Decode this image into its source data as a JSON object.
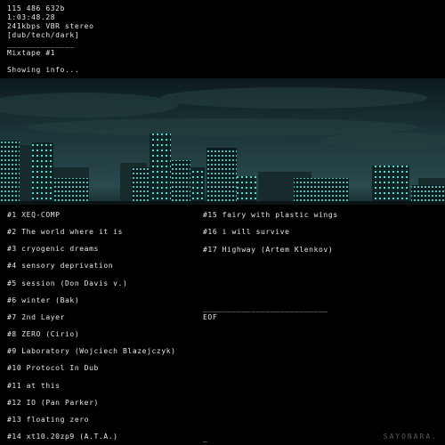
{
  "header": {
    "size": "115 486 632b",
    "duration": "1:03:48.28",
    "bitrate": "241kbps VBR stereo",
    "genre": "[dub/tech/dark]",
    "rule": "______________",
    "title": "Mixtape #1"
  },
  "status": "Showing info...",
  "colors": {
    "text": "#e6e6e6",
    "background": "#000000",
    "sky": "#1e3a3d",
    "window_glow": "#47d6cc"
  },
  "tracks": [
    "#1 XEQ-COMP",
    "#2 The world where it is",
    "#3 cryogenic dreams",
    "#4 sensory deprivation",
    "#5 session (Don Davis v.)",
    "#6 winter (Bak)",
    "#7 2nd Layer",
    "#8 ZERO (Cirio)",
    "#9 Laboratory (Wojciech Blazejczyk)",
    "#10 Protocol In Dub",
    "#11 at this",
    "#12 IO (Pan Parker)",
    "#13 floating zero",
    "#14 xt10.20zp9 (A.T.A.)",
    "#15 fairy with plastic wings",
    "#16 i will survive",
    "#17 Highway (Artem Klenkov)"
  ],
  "footer": {
    "rule": "__________________________",
    "eof": "EOF",
    "cursor": "_",
    "watermark": "SAYONARA."
  }
}
